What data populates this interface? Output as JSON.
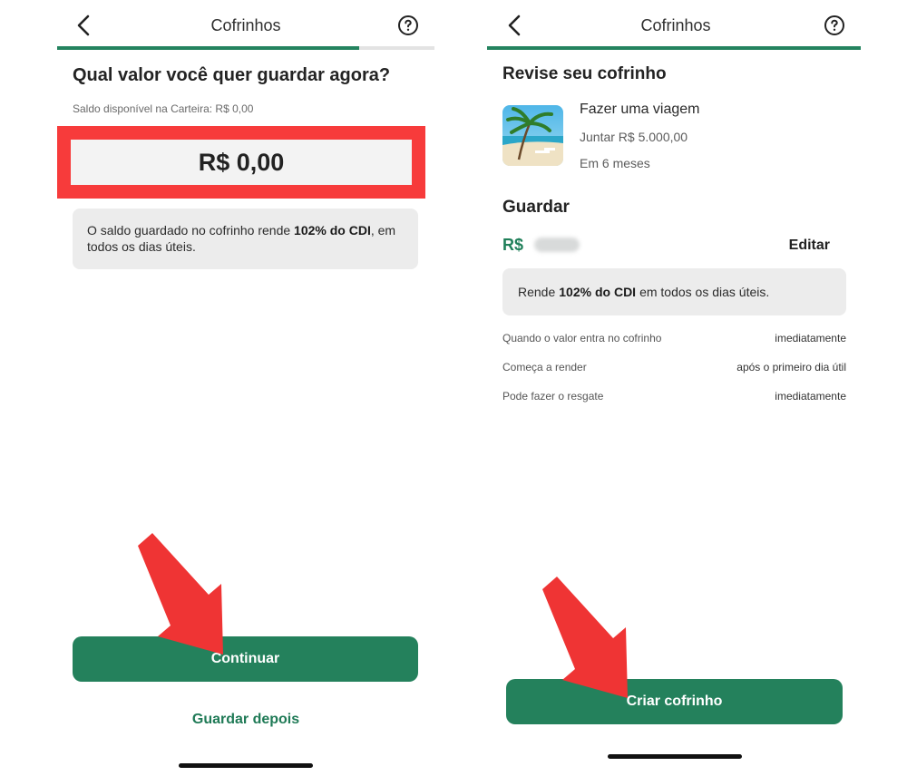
{
  "left_screen": {
    "header": {
      "title": "Cofrinhos",
      "back_icon": "chevron-left-icon",
      "help_icon": "question-circle-icon"
    },
    "progress": 0.8,
    "question": "Qual valor você quer guardar agora?",
    "balance_label": "Saldo disponível na Carteira: R$ 0,00",
    "amount_value": "R$ 0,00",
    "info": {
      "prefix": "O saldo guardado no cofrinho rende ",
      "bold": "102% do CDI",
      "suffix": ", em todos os dias úteis."
    },
    "continue_button": "Continuar",
    "later_link": "Guardar depois"
  },
  "right_screen": {
    "header": {
      "title": "Cofrinhos",
      "back_icon": "chevron-left-icon",
      "help_icon": "question-circle-icon"
    },
    "progress": 1.0,
    "review_title": "Revise seu cofrinho",
    "goal": {
      "image_icon": "beach-photo",
      "name": "Fazer uma viagem",
      "amount": "Juntar R$  5.000,00",
      "deadline": "Em 6 meses"
    },
    "save_title": "Guardar",
    "save_currency": "R$",
    "edit_button": "Editar",
    "rate": {
      "prefix": "Rende",
      "bold": "102% do CDI",
      "suffix": "em todos os dias úteis."
    },
    "details": [
      {
        "label": "Quando o valor entra no cofrinho",
        "value": "imediatamente"
      },
      {
        "label": "Começa a render",
        "value": "após o primeiro dia útil"
      },
      {
        "label": "Pode fazer o resgate",
        "value": "imediatamente"
      }
    ],
    "create_button": "Criar cofrinho"
  },
  "colors": {
    "brand_green": "#24835f",
    "highlight_red": "#f73b3b",
    "annotation_arrow_red": "#ef3434"
  }
}
